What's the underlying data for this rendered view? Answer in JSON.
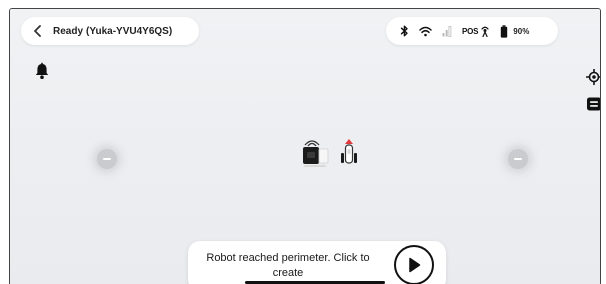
{
  "header": {
    "status": "Ready",
    "robot_id": "(Yuka-YVU4Y6QS)"
  },
  "connectivity": {
    "icons": [
      "bluetooth-icon",
      "wifi-icon",
      "cellular-signal-icon",
      "pos-satellite-icon",
      "battery-icon"
    ],
    "pos_label": "POS",
    "battery_percent": "90%"
  },
  "controls": {
    "left": [
      "bell-icon"
    ],
    "right": [
      "locate-icon",
      "layers-icon"
    ]
  },
  "map": {
    "markers": [
      "map-marker-left",
      "map-marker-right"
    ],
    "dock": "charging-dock",
    "robot": "robot-mower"
  },
  "bottom": {
    "message": "Robot reached perimeter. Click to create",
    "action_icon": "play-icon"
  },
  "colors": {
    "map_background": "#eceef1",
    "accent_red": "#e0393e",
    "text_dark": "#1a1a1a"
  }
}
